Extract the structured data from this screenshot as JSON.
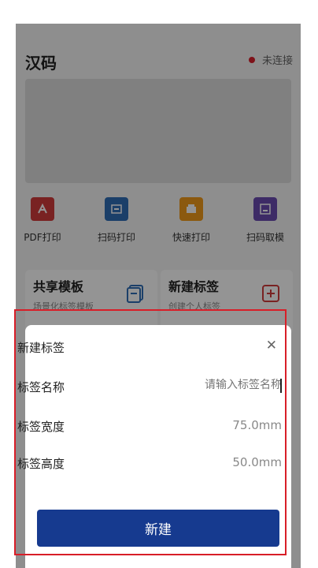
{
  "app": {
    "title": "汉码",
    "status": "未连接",
    "status_color": "#d9202c"
  },
  "quick_actions": [
    {
      "label": "PDF打印",
      "icon": "pdf-icon",
      "color": "#d13b3b"
    },
    {
      "label": "扫码打印",
      "icon": "scan-print-icon",
      "color": "#2f6db5"
    },
    {
      "label": "快速打印",
      "icon": "quick-print-icon",
      "color": "#f09a1a"
    },
    {
      "label": "扫码取模",
      "icon": "scan-template-icon",
      "color": "#6a4bb0"
    }
  ],
  "cards": [
    {
      "title": "共享模板",
      "subtitle": "场景化标签模板",
      "icon": "template-icon"
    },
    {
      "title": "新建标签",
      "subtitle": "创建个人标签",
      "icon": "add-label-icon"
    }
  ],
  "sheet": {
    "title": "新建标签",
    "fields": [
      {
        "label": "标签名称",
        "placeholder": "请输入标签名称"
      },
      {
        "label": "标签宽度",
        "value": "75.0mm"
      },
      {
        "label": "标签高度",
        "value": "50.0mm"
      }
    ],
    "submit": "新建"
  }
}
